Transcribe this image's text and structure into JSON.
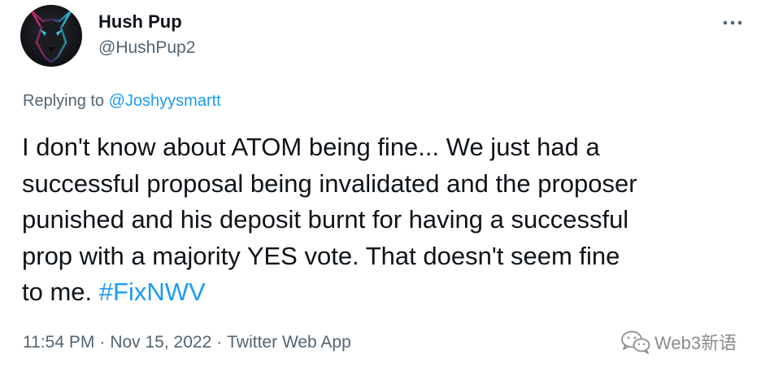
{
  "author": {
    "display_name": "Hush Pup",
    "handle": "@HushPup2",
    "avatar_icon": "wolf-avatar"
  },
  "reply": {
    "prefix": "Replying to",
    "mention": "@Joshyysmartt"
  },
  "tweet": {
    "lines": [
      "I don't know about ATOM being fine... We just had a",
      "successful proposal being invalidated and the proposer",
      "punished and his deposit burnt for having a successful",
      "prop with a majority YES vote. That doesn't seem fine",
      "to me."
    ],
    "hashtag": "#FixNWV"
  },
  "meta": {
    "time": "11:54 PM",
    "separator": "·",
    "date": "Nov 15, 2022",
    "source": "Twitter Web App"
  },
  "watermark": {
    "text": "Web3新语",
    "icon": "wechat-icon"
  },
  "colors": {
    "text": "#0f1419",
    "secondary": "#536471",
    "accent": "#1d9bf0"
  }
}
